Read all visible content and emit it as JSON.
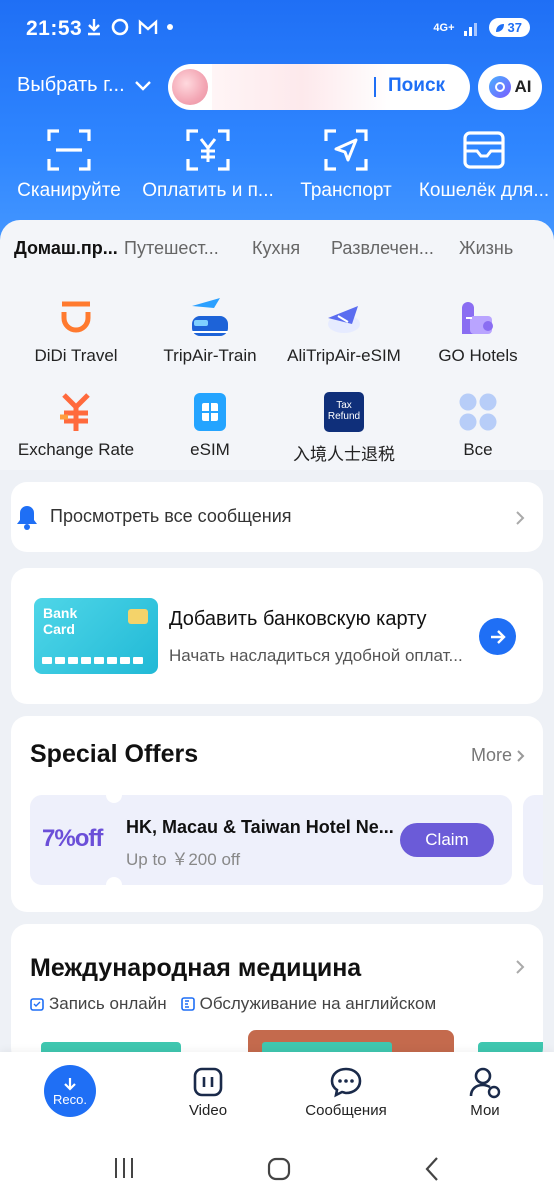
{
  "status": {
    "time": "21:53",
    "network": "4G+",
    "battery": "37"
  },
  "topbar": {
    "city_label": "Выбрать г...",
    "search_button": "Поиск",
    "ai_label": "AI"
  },
  "quick_actions": [
    {
      "label": "Сканируйте",
      "icon": "scan-icon"
    },
    {
      "label": "Оплатить и п...",
      "icon": "yuan-pay-icon"
    },
    {
      "label": "Транспорт",
      "icon": "transport-icon"
    },
    {
      "label": "Кошелёк для...",
      "icon": "wallet-icon"
    }
  ],
  "tabs": [
    "Домаш.пр...",
    "Путешест...",
    "Кухня",
    "Развлечен...",
    "Жизнь"
  ],
  "services": [
    {
      "label": "DiDi Travel"
    },
    {
      "label": "TripAir-Train"
    },
    {
      "label": "AliTripAir-eSIM"
    },
    {
      "label": "GO Hotels"
    },
    {
      "label": "Exchange Rate"
    },
    {
      "label": "eSIM"
    },
    {
      "label": "入境人士退税",
      "icon_text": "Tax Refund"
    },
    {
      "label": "Все"
    }
  ],
  "messages": {
    "label": "Просмотреть все сообщения"
  },
  "bank": {
    "card_text": "Bank Card",
    "title": "Добавить банковскую карту",
    "subtitle": "Начать насладиться удобной оплат..."
  },
  "offers": {
    "title": "Special Offers",
    "more": "More",
    "coupon": {
      "discount": "7%off",
      "title": "HK, Macau & Taiwan Hotel Ne...",
      "subtitle": "Up to ￥200 off",
      "claim": "Claim"
    }
  },
  "medicine": {
    "title": "Международная медицина",
    "tag1": "Запись онлайн",
    "tag2": "Обслуживание на английском"
  },
  "bottom_nav": {
    "reco": "Reco.",
    "video": "Video",
    "messages": "Сообщения",
    "me": "Мои"
  },
  "colors": {
    "brand": "#1f6ff5",
    "claim": "#6b5bd8",
    "discount": "#6b4fd8"
  }
}
